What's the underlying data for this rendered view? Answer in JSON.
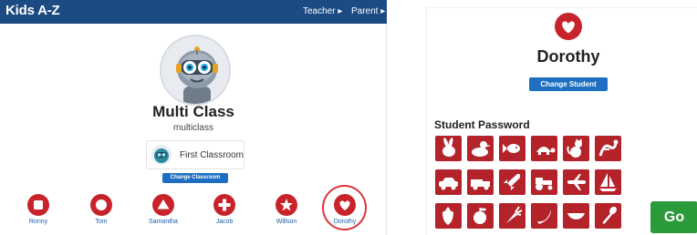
{
  "header": {
    "brand": "Kids A-Z",
    "nav_teacher": "Teacher ▸",
    "nav_parent": "Parent ▸"
  },
  "classroom": {
    "title": "Multi Class",
    "subtitle": "multiclass",
    "classroom_name": "First Classroom",
    "change_classroom_label": "Change Classroom"
  },
  "students": [
    {
      "name": "Ronny",
      "icon": "square-icon"
    },
    {
      "name": "Tom",
      "icon": "circle-icon"
    },
    {
      "name": "Samantha",
      "icon": "triangle-icon"
    },
    {
      "name": "Jacob",
      "icon": "plus-icon"
    },
    {
      "name": "Willson",
      "icon": "star-icon"
    },
    {
      "name": "Dorothy",
      "icon": "heart-icon",
      "selected": true
    }
  ],
  "login": {
    "student_name": "Dorothy",
    "change_student_label": "Change Student",
    "password_heading": "Student Password",
    "go_label": "Go",
    "password_icons": [
      [
        "rabbit-icon",
        "duck-icon",
        "fish-icon",
        "turtle-icon",
        "cat-icon",
        "lizard-icon"
      ],
      [
        "car-icon",
        "truck-icon",
        "rocket-icon",
        "tractor-icon",
        "airplane-icon",
        "sailboat-icon"
      ],
      [
        "strawberry-icon",
        "apple-icon",
        "carrot-icon",
        "banana-icon",
        "watermelon-icon",
        "spoon-icon"
      ]
    ]
  },
  "colors": {
    "header_bg": "#1c4a82",
    "accent_red": "#c8232b",
    "button_blue": "#1e6fc1",
    "go_green": "#2a9a3a",
    "link_blue": "#1e5eaa"
  }
}
